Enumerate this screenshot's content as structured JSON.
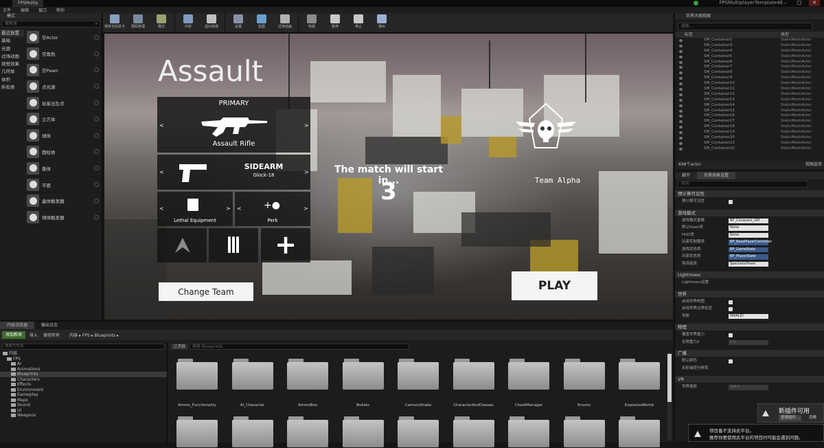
{
  "window": {
    "tab_title": "FPSMultip",
    "project_name": "FPSMultiplayerTemplate48"
  },
  "menu": {
    "items": [
      "文件",
      "编辑",
      "窗口",
      "帮助"
    ]
  },
  "modes": {
    "title": "模式",
    "search_placeholder": "搜索类",
    "categories": [
      "最近放置",
      "基础",
      "光源",
      "过场动画",
      "视觉效果",
      "几何体",
      "体积",
      "所有类"
    ],
    "items": [
      "空Actor",
      "空角色",
      "空Pawn",
      "点光源",
      "玩家出生点",
      "立方体",
      "球体",
      "圆柱体",
      "锥体",
      "平面",
      "盒体触发器",
      "球体触发器"
    ]
  },
  "toolbar": {
    "buttons": [
      "保存当前关卡",
      "源码管理",
      "模式",
      "内容",
      "虚幻商城",
      "设置",
      "蓝图",
      "过场动画",
      "构建",
      "暂停",
      "停止",
      "弹出"
    ]
  },
  "viewport": {
    "page_title": "Assault",
    "primary": {
      "header": "PRIMARY",
      "weapon": "Assault Rifle"
    },
    "sidearm": {
      "header": "SIDEARM",
      "weapon": "Glock-18"
    },
    "lethal": "Lethal Equipment",
    "perk": "Perk",
    "arrow_left": "<",
    "arrow_right": ">",
    "change_team": "Change Team",
    "countdown_text": "The match will start in...",
    "countdown_value": "3",
    "team_name": "Team Alpha",
    "play": "PLAY"
  },
  "outliner": {
    "title": "世界大纲视图",
    "search_placeholder": "搜索...",
    "col_label": "标签",
    "col_type": "类型",
    "rows": [
      {
        "name": "SM_Container2",
        "type": "StaticMeshActor"
      },
      {
        "name": "SM_Container3",
        "type": "StaticMeshActor"
      },
      {
        "name": "SM_Container4",
        "type": "StaticMeshActor"
      },
      {
        "name": "SM_Container5",
        "type": "StaticMeshActor"
      },
      {
        "name": "SM_Container6",
        "type": "StaticMeshActor"
      },
      {
        "name": "SM_Container7",
        "type": "StaticMeshActor"
      },
      {
        "name": "SM_Container8",
        "type": "StaticMeshActor"
      },
      {
        "name": "SM_Container9",
        "type": "StaticMeshActor"
      },
      {
        "name": "SM_Container10",
        "type": "StaticMeshActor"
      },
      {
        "name": "SM_Container11",
        "type": "StaticMeshActor"
      },
      {
        "name": "SM_Container12",
        "type": "StaticMeshActor"
      },
      {
        "name": "SM_Container13",
        "type": "StaticMeshActor"
      },
      {
        "name": "SM_Container14",
        "type": "StaticMeshActor"
      },
      {
        "name": "SM_Container15",
        "type": "StaticMeshActor"
      },
      {
        "name": "SM_Container16",
        "type": "StaticMeshActor"
      },
      {
        "name": "SM_Container17",
        "type": "StaticMeshActor"
      },
      {
        "name": "SM_Container18",
        "type": "StaticMeshActor"
      },
      {
        "name": "SM_Container19",
        "type": "StaticMeshActor"
      },
      {
        "name": "SM_Container20",
        "type": "StaticMeshActor"
      },
      {
        "name": "SM_Container21",
        "type": "StaticMeshActor"
      },
      {
        "name": "SM_Container22",
        "type": "StaticMeshActor"
      }
    ],
    "actor_count": "698个actor",
    "view_options": "视图选项"
  },
  "details": {
    "tabs": [
      "细节",
      "世界场景设置"
    ],
    "search_placeholder": "搜索",
    "sections": [
      {
        "title": "预计算可见性",
        "rows": [
          {
            "label": "预计算可见性",
            "kind": "check"
          }
        ]
      },
      {
        "title": "游戏模式",
        "rows": [
          {
            "label": "游戏模式重载",
            "kind": "dropdown",
            "value": "BP_Conquest_GM"
          },
          {
            "label": "默认Pawn类",
            "kind": "dropdown",
            "value": "None"
          },
          {
            "label": "HUD类",
            "kind": "dropdown",
            "value": "None"
          },
          {
            "label": "玩家控制器类",
            "kind": "dropdown",
            "value": "BP_BasePlayerController",
            "blue": true
          },
          {
            "label": "游戏状态类",
            "kind": "dropdown",
            "value": "BP_GameState",
            "blue": true
          },
          {
            "label": "玩家状态类",
            "kind": "dropdown",
            "value": "BP_PlayerState",
            "blue": true
          },
          {
            "label": "旁观者类",
            "kind": "dropdown",
            "value": "SpectatorPawn"
          }
        ]
      },
      {
        "title": "Lightmass",
        "rows": [
          {
            "label": "Lightmass设置",
            "kind": "text"
          }
        ]
      },
      {
        "title": "世界",
        "rows": [
          {
            "label": "启用世界构图",
            "kind": "check"
          },
          {
            "label": "启用世界边界检查",
            "kind": "check"
          },
          {
            "label": "导航",
            "kind": "dropdown",
            "value": "INVALID"
          }
        ]
      },
      {
        "title": "物理",
        "rows": [
          {
            "label": "覆盖世界重力",
            "kind": "check"
          },
          {
            "label": "全局重力Z",
            "kind": "number",
            "value": "0.0"
          }
        ]
      },
      {
        "title": "广播",
        "rows": [
          {
            "label": "默认颜色",
            "kind": "check"
          },
          {
            "label": "反射捕获分辨率",
            "kind": "text"
          }
        ]
      },
      {
        "title": "VR",
        "rows": [
          {
            "label": "世界缩放",
            "kind": "number",
            "value": "100.0"
          }
        ]
      }
    ]
  },
  "content_browser": {
    "tabs": [
      "内容浏览器",
      "输出日志"
    ],
    "add_new": "添加新项",
    "import": "导入",
    "save_all": "保存所有",
    "breadcrumb": [
      "内容",
      "FPS",
      "Blueprints"
    ],
    "tree_search": "搜索文件夹",
    "tree": [
      {
        "label": "内容",
        "depth": 0
      },
      {
        "label": "FPS",
        "depth": 1
      },
      {
        "label": "AI",
        "depth": 2
      },
      {
        "label": "Animations",
        "depth": 2
      },
      {
        "label": "Blueprints",
        "depth": 2,
        "selected": true
      },
      {
        "label": "Characters",
        "depth": 2
      },
      {
        "label": "Effects",
        "depth": 2
      },
      {
        "label": "Environment",
        "depth": 2
      },
      {
        "label": "Gameplay",
        "depth": 2
      },
      {
        "label": "Maps",
        "depth": 2
      },
      {
        "label": "Sound",
        "depth": 2
      },
      {
        "label": "UI",
        "depth": 2
      },
      {
        "label": "Weapons",
        "depth": 2
      }
    ],
    "filter_label": "过滤器",
    "search_placeholder": "搜索 Blueprints",
    "folders": [
      "Ammo_Functionality",
      "AI_Character",
      "AmmoBox",
      "Bullets",
      "CameraShake",
      "CharacterAndClasses",
      "CheatManager",
      "Enums",
      "ExplosiveBomb"
    ]
  },
  "notification": {
    "title": "新插件可用",
    "button": "管理插件...",
    "dismiss": "忽略"
  },
  "toast": {
    "line1": "项目备不支持此平台。",
    "line2": "推荐你要使用此平台的项目时可能会遇到问题。"
  }
}
